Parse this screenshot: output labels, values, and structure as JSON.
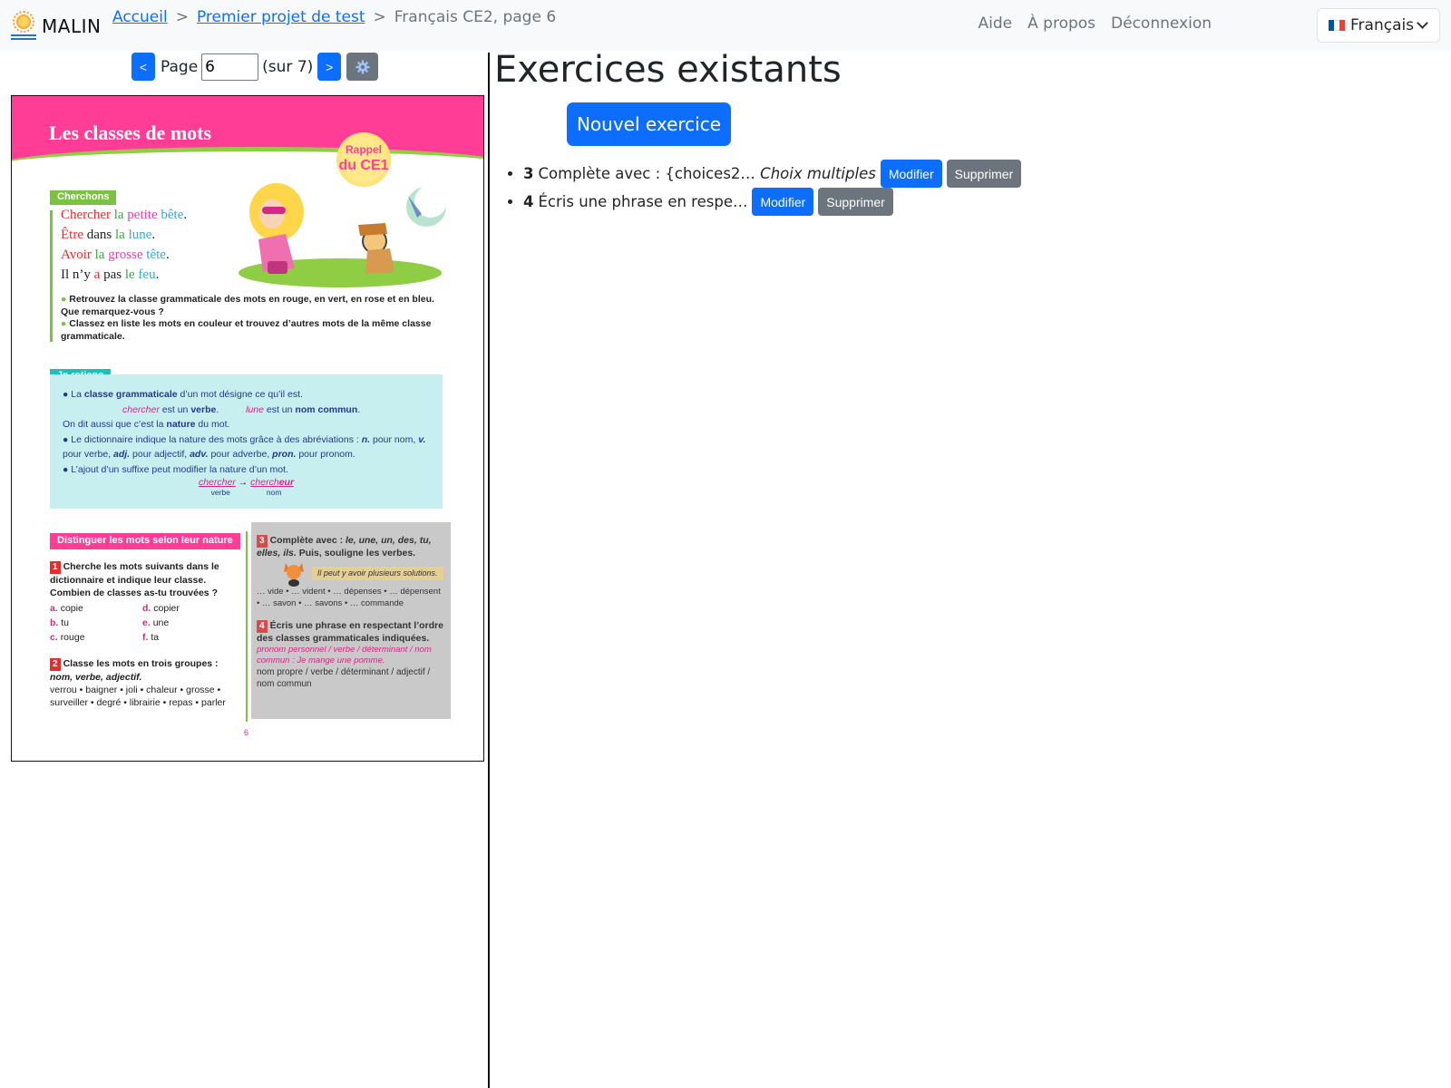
{
  "navbar": {
    "brand": "MALIN",
    "breadcrumbs": [
      "Accueil",
      "Premier projet de test",
      "Français CE2, page 6"
    ],
    "links": [
      "Aide",
      "À propos",
      "Déconnexion"
    ],
    "language": "Français"
  },
  "pager": {
    "prev": "<",
    "label": "Page",
    "value": "6",
    "total": "(sur 7)",
    "next": ">",
    "settings_icon": "gear-icon"
  },
  "textbook": {
    "title": "Les classes de mots",
    "rappel": [
      "Rappel",
      "du CE1"
    ],
    "cherchons_tag": "Cherchons",
    "phrases": [
      [
        [
          "Chercher",
          "red"
        ],
        [
          " la ",
          "green"
        ],
        [
          "petite",
          "pink"
        ],
        [
          " bête",
          "blue"
        ],
        [
          ".",
          "dark"
        ]
      ],
      [
        [
          "Être",
          "red"
        ],
        [
          " dans ",
          "dark"
        ],
        [
          "la",
          "green"
        ],
        [
          " lune",
          "blue"
        ],
        [
          ".",
          "dark"
        ]
      ],
      [
        [
          "Avoir",
          "red"
        ],
        [
          " la ",
          "green"
        ],
        [
          "grosse",
          "pink"
        ],
        [
          " tête",
          "blue"
        ],
        [
          ".",
          "dark"
        ]
      ],
      [
        [
          "Il n’y ",
          "dark"
        ],
        [
          "a",
          "red"
        ],
        [
          " pas ",
          "dark"
        ],
        [
          "le",
          "green"
        ],
        [
          " feu",
          "blue"
        ],
        [
          ".",
          "dark"
        ]
      ]
    ],
    "instructions": [
      "Retrouvez la classe grammaticale des mots en rouge, en vert, en rose et en bleu. Que remarquez-vous ?",
      "Classez en liste les mots en couleur et trouvez d’autres mots de la même classe grammaticale."
    ],
    "retiens_tag": "Je retiens",
    "retiens": {
      "p1_a": "La ",
      "p1_b": "classe grammaticale",
      "p1_c": " d’un mot désigne ce qu’il est.",
      "ex1_word": "chercher",
      "ex1_rest": " est un ",
      "ex1_class": "verbe",
      "ex2_word": "lune",
      "ex2_rest": " est un ",
      "ex2_class": "nom commun",
      "p2_a": "On dit aussi que c’est la ",
      "p2_b": "nature",
      "p2_c": " du mot.",
      "p3": "Le dictionnaire indique la nature des mots grâce à des abréviations :",
      "abbr_n": "n.",
      "abbr_n_txt": " pour nom, ",
      "abbr_v": "v.",
      "abbr_v_txt": " pour verbe, ",
      "abbr_adj": "adj.",
      "abbr_adj_txt": " pour adjectif, ",
      "abbr_adv": "adv.",
      "abbr_adv_txt": " pour adverbe, ",
      "abbr_pron": "pron.",
      "abbr_pron_txt": " pour pronom.",
      "p4": "L’ajout d’un suffixe peut modifier la nature d’un mot.",
      "suffix_from": "chercher",
      "suffix_to_a": "cherch",
      "suffix_to_b": "eur",
      "suffix_from_label": "verbe",
      "suffix_to_label": "nom"
    },
    "section_tag": "Distinguer les mots selon leur nature",
    "ex1": {
      "num": "1",
      "prompt": "Cherche les mots suivants dans le dictionnaire et indique leur classe. Combien de classes as-tu trouvées ?",
      "items": [
        [
          "a.",
          "copie"
        ],
        [
          "d.",
          "copier"
        ],
        [
          "b.",
          "tu"
        ],
        [
          "e.",
          "une"
        ],
        [
          "c.",
          "rouge"
        ],
        [
          "f.",
          "ta"
        ]
      ]
    },
    "ex2": {
      "num": "2",
      "prompt_a": "Classe les mots en trois groupes :",
      "prompt_b": "nom, verbe, adjectif.",
      "words": "verrou • baigner • joli • chaleur • grosse • surveiller • degré • librairie • repas • parler"
    },
    "ex3": {
      "num": "3",
      "prompt_a": "Complète avec : ",
      "prompt_b": "le, une, un, des, tu, elles, ils.",
      "prompt_c": " Puis, souligne les verbes.",
      "hint": "Il peut y avoir plusieurs solutions.",
      "words": "… vide • … vident • … dépenses • … dépensent • … savon • … savons • … commande"
    },
    "ex4": {
      "num": "4",
      "prompt": "Écris une phrase en respectant l’ordre des classes grammaticales indiquées.",
      "example": "pronom personnel / verbe / déterminant / nom commun : Je mange une pomme.",
      "order": "nom propre / verbe / déterminant / adjectif / nom commun"
    },
    "page_number": "6"
  },
  "exercises": {
    "heading": "Exercices existants",
    "new_button": "Nouvel exercice",
    "items": [
      {
        "num": "3",
        "text": "Complète avec : {choices2…",
        "type": "Choix multiples",
        "edit": "Modifier",
        "delete": "Supprimer"
      },
      {
        "num": "4",
        "text": "Écris une phrase en respe…",
        "type": "",
        "edit": "Modifier",
        "delete": "Supprimer"
      }
    ]
  },
  "colors": {
    "primary": "#0d6efd",
    "secondary": "#6c757d",
    "book_pink": "#ff3d97",
    "book_green": "#7cc242",
    "book_teal": "#1dbfb8"
  }
}
